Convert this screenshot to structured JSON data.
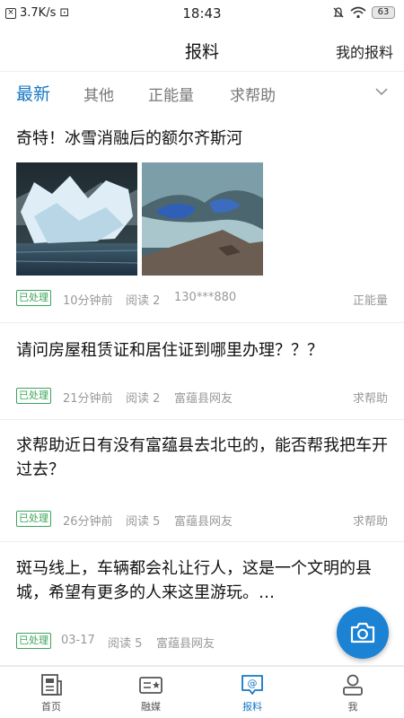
{
  "status": {
    "speed": "3.7K/s",
    "time": "18:43",
    "battery": "63"
  },
  "header": {
    "title": "报料",
    "right_link": "我的报料"
  },
  "tabs": [
    {
      "label": "最新",
      "active": true
    },
    {
      "label": "其他",
      "active": false
    },
    {
      "label": "正能量",
      "active": false
    },
    {
      "label": "求帮助",
      "active": false
    }
  ],
  "posts": [
    {
      "title": "奇特！冰雪消融后的额尔齐斯河",
      "status": "已处理",
      "time": "10分钟前",
      "reads": "阅读 2",
      "author": "130***880",
      "category": "正能量"
    },
    {
      "title": "请问房屋租赁证和居住证到哪里办理？？？",
      "status": "已处理",
      "time": "21分钟前",
      "reads": "阅读 2",
      "author": "富蕴县网友",
      "category": "求帮助"
    },
    {
      "title": "求帮助近日有没有富蕴县去北屯的，能否帮我把车开过去？",
      "status": "已处理",
      "time": "26分钟前",
      "reads": "阅读 5",
      "author": "富蕴县网友",
      "category": "求帮助"
    },
    {
      "title": "斑马线上，车辆都会礼让行人，这是一个文明的县城，希望有更多的人来这里游玩。…",
      "status": "已处理",
      "time": "03-17",
      "reads": "阅读 5",
      "author": "富蕴县网友",
      "category": ""
    }
  ],
  "nav": [
    {
      "label": "首页",
      "icon": "news-icon",
      "active": false
    },
    {
      "label": "融媒",
      "icon": "media-card-icon",
      "active": false
    },
    {
      "label": "报料",
      "icon": "report-chat-icon",
      "active": true
    },
    {
      "label": "我",
      "icon": "user-icon",
      "active": false
    }
  ],
  "colors": {
    "accent": "#1677c4",
    "badge": "#3aa55a",
    "fab": "#1b82d4"
  }
}
